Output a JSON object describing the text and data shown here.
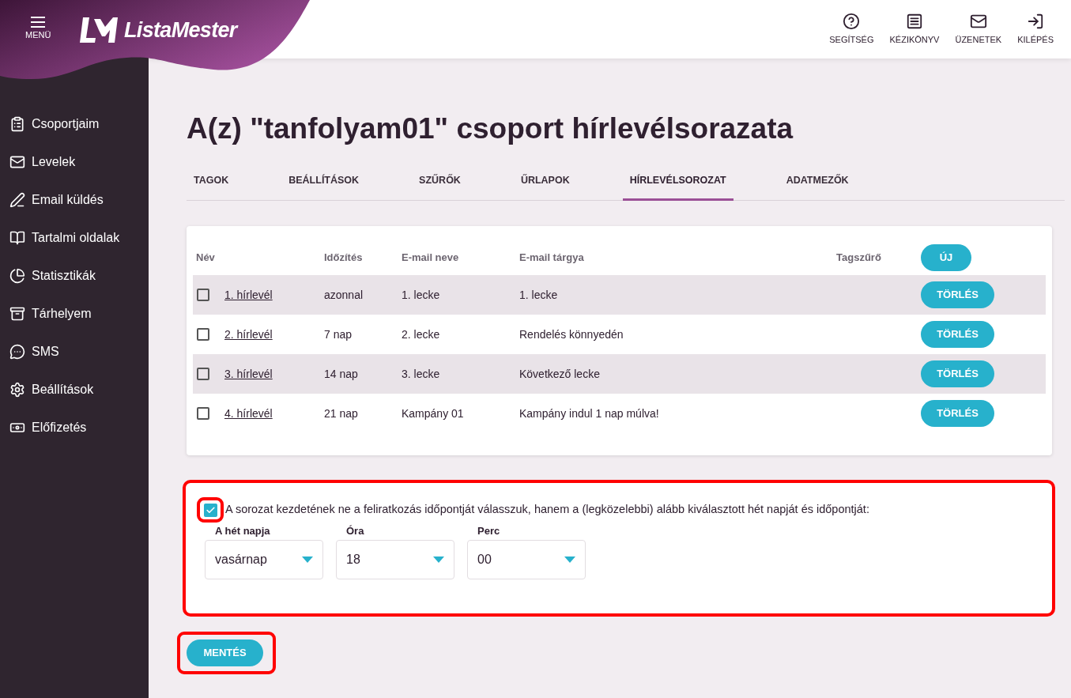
{
  "header": {
    "menu_label": "MENÜ",
    "logo": "ListaMester",
    "top_nav": [
      {
        "label": "SEGÍTSÉG"
      },
      {
        "label": "KÉZIKÖNYV"
      },
      {
        "label": "ÜZENETEK"
      },
      {
        "label": "KILÉPÉS"
      }
    ]
  },
  "sidebar": {
    "items": [
      {
        "label": "Csoportjaim"
      },
      {
        "label": "Levelek"
      },
      {
        "label": "Email küldés"
      },
      {
        "label": "Tartalmi oldalak"
      },
      {
        "label": "Statisztikák"
      },
      {
        "label": "Tárhelyem"
      },
      {
        "label": "SMS"
      },
      {
        "label": "Beállítások"
      },
      {
        "label": "Előfizetés"
      }
    ]
  },
  "title": "A(z) \"tanfolyam01\" csoport hírlevélsorazata",
  "tabs": [
    {
      "label": "TAGOK",
      "selected": false
    },
    {
      "label": "BEÁLLÍTÁSOK",
      "selected": false
    },
    {
      "label": "SZŰRŐK",
      "selected": false
    },
    {
      "label": "ŰRLAPOK",
      "selected": false
    },
    {
      "label": "HÍRLEVÉLSOROZAT",
      "selected": true
    },
    {
      "label": "ADATMEZŐK",
      "selected": false
    }
  ],
  "table": {
    "columns": [
      "Név",
      "Időzítés",
      "E-mail neve",
      "E-mail tárgya",
      "Tagszűrő"
    ],
    "new_button": "ÚJ",
    "rows": [
      {
        "checked": false,
        "name": "1. hírlevél",
        "timing": "azonnal",
        "email_name": "1. lecke",
        "subject": "1. lecke",
        "delete_button": "TÖRLÉS"
      },
      {
        "checked": false,
        "name": "2. hírlevél",
        "timing": "7 nap",
        "email_name": "2. lecke",
        "subject": "Rendelés könnyedén",
        "delete_button": "TÖRLÉS"
      },
      {
        "checked": false,
        "name": "3. hírlevél",
        "timing": "14 nap",
        "email_name": "3. lecke",
        "subject": "Következő lecke",
        "delete_button": "TÖRLÉS"
      },
      {
        "checked": false,
        "name": "4. hírlevél",
        "timing": "21 nap",
        "email_name": "Kampány 01",
        "subject": "Kampány indul 1 nap múlva!",
        "delete_button": "TÖRLÉS"
      }
    ]
  },
  "start_options": {
    "checked": true,
    "label": "A sorozat kezdetének ne a feliratkozás időpontját válasszuk, hanem a (legközelebbi) alább kiválasztott hét napját és időpontját:",
    "selects": [
      {
        "label": "A hét napja",
        "value": "vasárnap"
      },
      {
        "label": "Óra",
        "value": "18"
      },
      {
        "label": "Perc",
        "value": "00"
      }
    ]
  },
  "save_button": "MENTÉS"
}
